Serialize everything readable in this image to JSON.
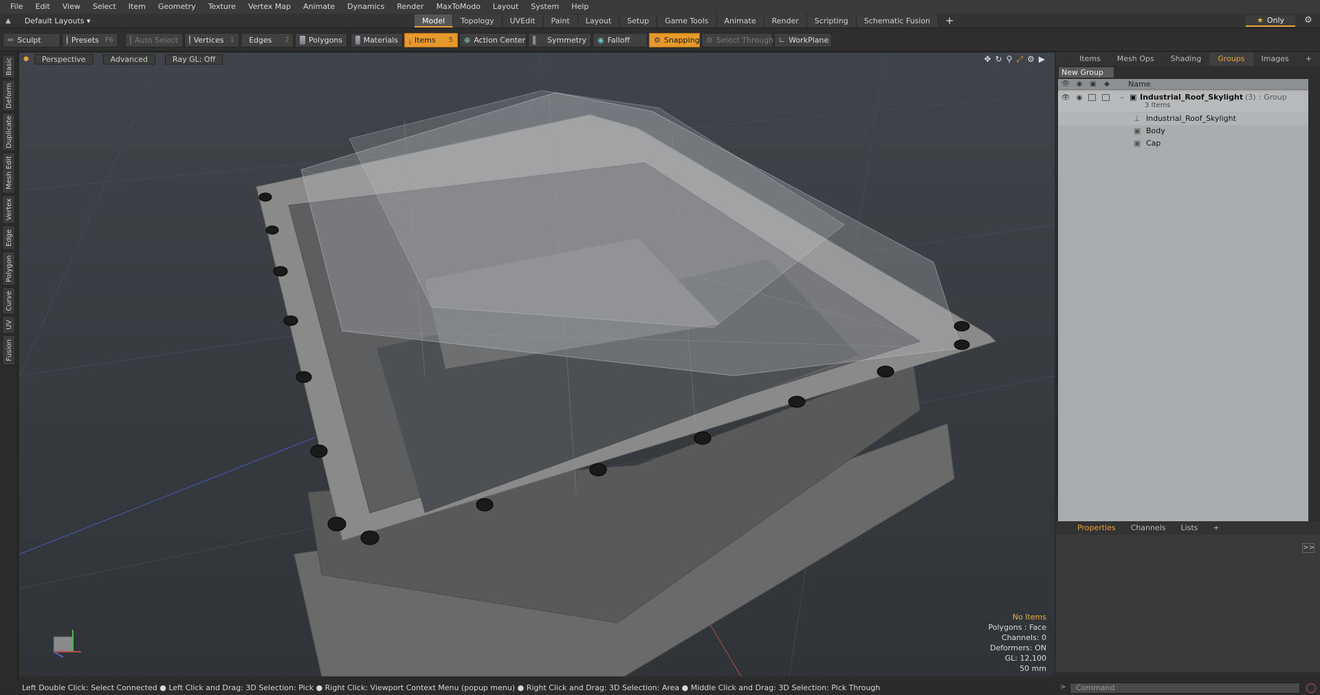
{
  "menu": [
    "File",
    "Edit",
    "View",
    "Select",
    "Item",
    "Geometry",
    "Texture",
    "Vertex Map",
    "Animate",
    "Dynamics",
    "Render",
    "MaxToModo",
    "Layout",
    "System",
    "Help"
  ],
  "layout_selector": "Default Layouts ▾",
  "top_tabs": [
    "Model",
    "Topology",
    "UVEdit",
    "Paint",
    "Layout",
    "Setup",
    "Game Tools",
    "Animate",
    "Render",
    "Scripting",
    "Schematic Fusion"
  ],
  "top_tabs_active": "Model",
  "only_label": "Only",
  "toolbar": {
    "sculpt": "Sculpt",
    "presets": "Presets",
    "presets_key": "F6",
    "auto_select": "Auto Select",
    "vertices": "Vertices",
    "vertices_key": "1",
    "edges": "Edges",
    "edges_key": "2",
    "polygons": "Polygons",
    "materials": "Materials",
    "items": "Items",
    "items_key": "5",
    "action_center": "Action Center",
    "symmetry": "Symmetry",
    "falloff": "Falloff",
    "snapping": "Snapping",
    "select_through": "Select Through",
    "workplane": "WorkPlane"
  },
  "left_tabs": [
    "Basic",
    "Deform",
    "Duplicate",
    "Mesh Edit",
    "Vertex",
    "Edge",
    "Polygon",
    "Curve",
    "UV",
    "Fusion"
  ],
  "viewport": {
    "perspective": "Perspective",
    "advanced": "Advanced",
    "raygl": "Ray GL: Off",
    "info_no_items": "No Items",
    "info_polygons": "Polygons : Face",
    "info_channels": "Channels: 0",
    "info_deformers": "Deformers: ON",
    "info_gl": "GL: 12,100",
    "info_scale": "50 mm"
  },
  "right_tabs": [
    "Items",
    "Mesh Ops",
    "Shading",
    "Groups",
    "Images"
  ],
  "right_tabs_active": "Groups",
  "new_group": "New Group",
  "groups": {
    "name_header": "Name",
    "group_name": "Industrial_Roof_Skylight",
    "group_count": "(3)",
    "group_type": ": Group",
    "group_items": "3 Items",
    "children": [
      "Industrial_Roof_Skylight",
      "Body",
      "Cap"
    ]
  },
  "bottom_tabs": [
    "Properties",
    "Channels",
    "Lists"
  ],
  "bottom_tabs_active": "Properties",
  "command_placeholder": "Command",
  "status_text": "Left Double Click: Select Connected ● Left Click and Drag: 3D Selection: Pick ● Right Click: Viewport Context Menu (popup menu) ● Right Click and Drag: 3D Selection: Area ● Middle Click and Drag: 3D Selection: Pick Through"
}
